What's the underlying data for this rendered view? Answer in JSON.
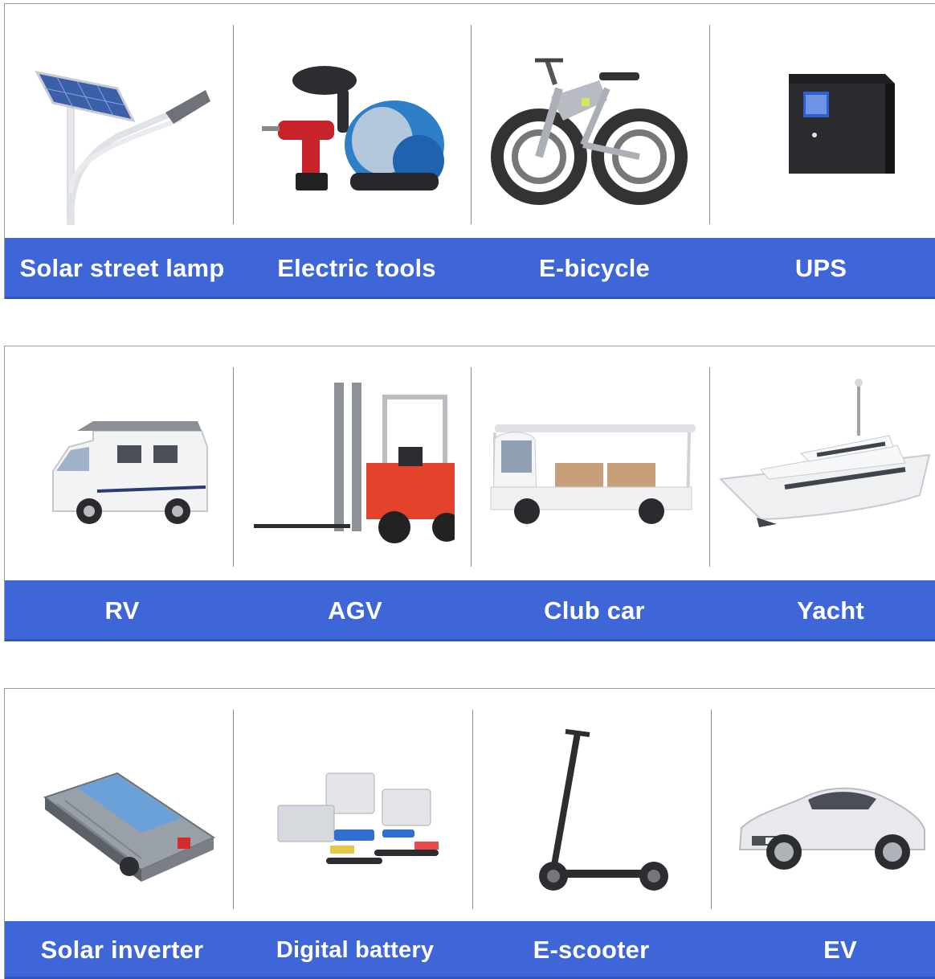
{
  "rows": [
    {
      "items": [
        {
          "label": "Solar street lamp",
          "icon": "solar-street-lamp-icon"
        },
        {
          "label": "Electric tools",
          "icon": "electric-tools-icon"
        },
        {
          "label": "E-bicycle",
          "icon": "e-bicycle-icon"
        },
        {
          "label": "UPS",
          "icon": "ups-icon"
        }
      ]
    },
    {
      "items": [
        {
          "label": "RV",
          "icon": "rv-icon"
        },
        {
          "label": "AGV",
          "icon": "forklift-icon"
        },
        {
          "label": "Club car",
          "icon": "club-car-icon"
        },
        {
          "label": "Yacht",
          "icon": "yacht-icon"
        }
      ]
    },
    {
      "items": [
        {
          "label": "Solar inverter",
          "icon": "solar-inverter-icon"
        },
        {
          "label": "Digital battery",
          "icon": "digital-battery-icon"
        },
        {
          "label": "E-scooter",
          "icon": "e-scooter-icon"
        },
        {
          "label": "EV",
          "icon": "ev-car-icon"
        }
      ]
    }
  ],
  "colors": {
    "bar": "#3e66d6",
    "label_text": "#ffffff",
    "divider": "#8c8c8c"
  }
}
